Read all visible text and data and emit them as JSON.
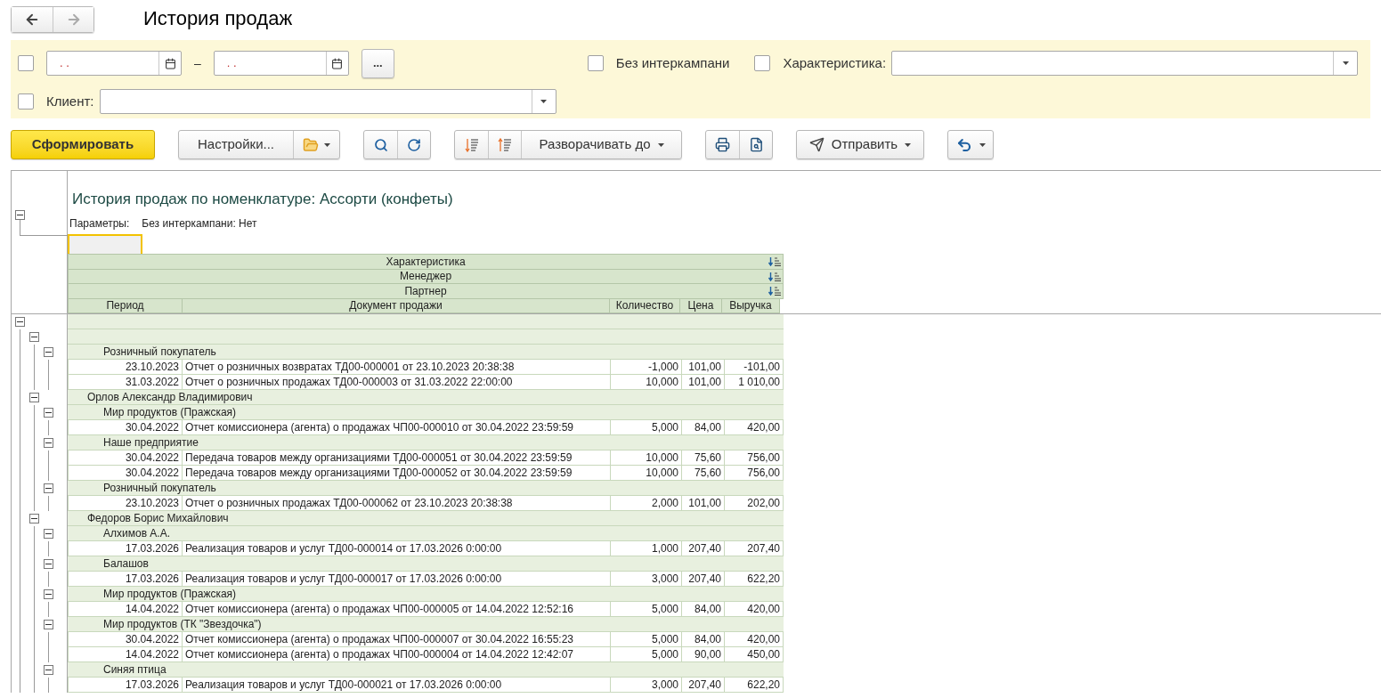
{
  "nav_buttons": [
    {
      "kind": "back",
      "disabled": false
    },
    {
      "kind": "forward",
      "disabled": true
    }
  ],
  "title": "История продаж",
  "filters": {
    "period": {
      "checked": false,
      "from": ". .",
      "to": ". .",
      "separator": "–",
      "choose_button": "..."
    },
    "without_intercompany": {
      "label": "Без интеркампани",
      "checked": false
    },
    "characteristic": {
      "label": "Характеристика:",
      "checked": false
    },
    "client": {
      "label": "Клиент:",
      "checked": false
    }
  },
  "toolbar": {
    "generate": "Сформировать",
    "settings": "Настройки...",
    "expand_to": "Разворачивать до",
    "send": "Отправить"
  },
  "report": {
    "title": "История продаж по номенклатуре: Ассорти (конфеты)",
    "params_label": "Параметры:",
    "params_value": "Без интеркампани: Нет",
    "expanded": true,
    "group_headers": [
      "Характеристика",
      "Менеджер",
      "Партнер"
    ],
    "columns": [
      "Период",
      "Документ продажи",
      "Количество",
      "Цена",
      "Выручка"
    ],
    "groups": [
      {
        "expanded": true,
        "children": [
          {
            "expanded": true,
            "children": [
              {
                "label": "Розничный покупатель",
                "expanded": true,
                "rows": [
                  [
                    "23.10.2023",
                    "Отчет о розничных возвратах ТД00-000001 от 23.10.2023 20:38:38",
                    "-1,000",
                    "101,00",
                    "-101,00"
                  ],
                  [
                    "31.03.2022",
                    "Отчет о розничных продажах ТД00-000003 от 31.03.2022 22:00:00",
                    "10,000",
                    "101,00",
                    "1 010,00"
                  ]
                ]
              }
            ]
          },
          {
            "label": "Орлов Александр Владимирович",
            "expanded": true,
            "children": [
              {
                "label": "Мир продуктов (Пражская)",
                "expanded": true,
                "rows": [
                  [
                    "30.04.2022",
                    "Отчет комиссионера (агента) о продажах ЧП00-000010 от 30.04.2022 23:59:59",
                    "5,000",
                    "84,00",
                    "420,00"
                  ]
                ]
              },
              {
                "label": "Наше предприятие",
                "expanded": true,
                "rows": [
                  [
                    "30.04.2022",
                    "Передача товаров между организациями ТД00-000051 от 30.04.2022 23:59:59",
                    "10,000",
                    "75,60",
                    "756,00"
                  ],
                  [
                    "30.04.2022",
                    "Передача товаров между организациями ТД00-000052 от 30.04.2022 23:59:59",
                    "10,000",
                    "75,60",
                    "756,00"
                  ]
                ]
              },
              {
                "label": "Розничный покупатель",
                "expanded": true,
                "rows": [
                  [
                    "23.10.2023",
                    "Отчет о розничных продажах ТД00-000062 от 23.10.2023 20:38:38",
                    "2,000",
                    "101,00",
                    "202,00"
                  ]
                ]
              }
            ]
          },
          {
            "label": "Федоров Борис Михайлович",
            "expanded": true,
            "children": [
              {
                "label": "Алхимов А.А.",
                "expanded": true,
                "rows": [
                  [
                    "17.03.2026",
                    "Реализация товаров и услуг ТД00-000014 от 17.03.2026 0:00:00",
                    "1,000",
                    "207,40",
                    "207,40"
                  ]
                ]
              },
              {
                "label": "Балашов",
                "expanded": true,
                "rows": [
                  [
                    "17.03.2026",
                    "Реализация товаров и услуг ТД00-000017 от 17.03.2026 0:00:00",
                    "3,000",
                    "207,40",
                    "622,20"
                  ]
                ]
              },
              {
                "label": "Мир продуктов (Пражская)",
                "expanded": true,
                "rows": [
                  [
                    "14.04.2022",
                    "Отчет комиссионера (агента) о продажах ЧП00-000005 от 14.04.2022 12:52:16",
                    "5,000",
                    "84,00",
                    "420,00"
                  ]
                ]
              },
              {
                "label": "Мир продуктов (ТК \"Звездочка\")",
                "expanded": true,
                "rows": [
                  [
                    "30.04.2022",
                    "Отчет комиссионера (агента) о продажах ЧП00-000007 от 30.04.2022 16:55:23",
                    "5,000",
                    "84,00",
                    "420,00"
                  ],
                  [
                    "14.04.2022",
                    "Отчет комиссионера (агента) о продажах ЧП00-000004 от 14.04.2022 12:42:07",
                    "5,000",
                    "90,00",
                    "450,00"
                  ]
                ]
              },
              {
                "label": "Синяя птица",
                "expanded": true,
                "rows": [
                  [
                    "17.03.2026",
                    "Реализация товаров и услуг ТД00-000021 от 17.03.2026 0:00:00",
                    "3,000",
                    "207,40",
                    "622,20"
                  ]
                ]
              }
            ]
          }
        ]
      }
    ]
  }
}
